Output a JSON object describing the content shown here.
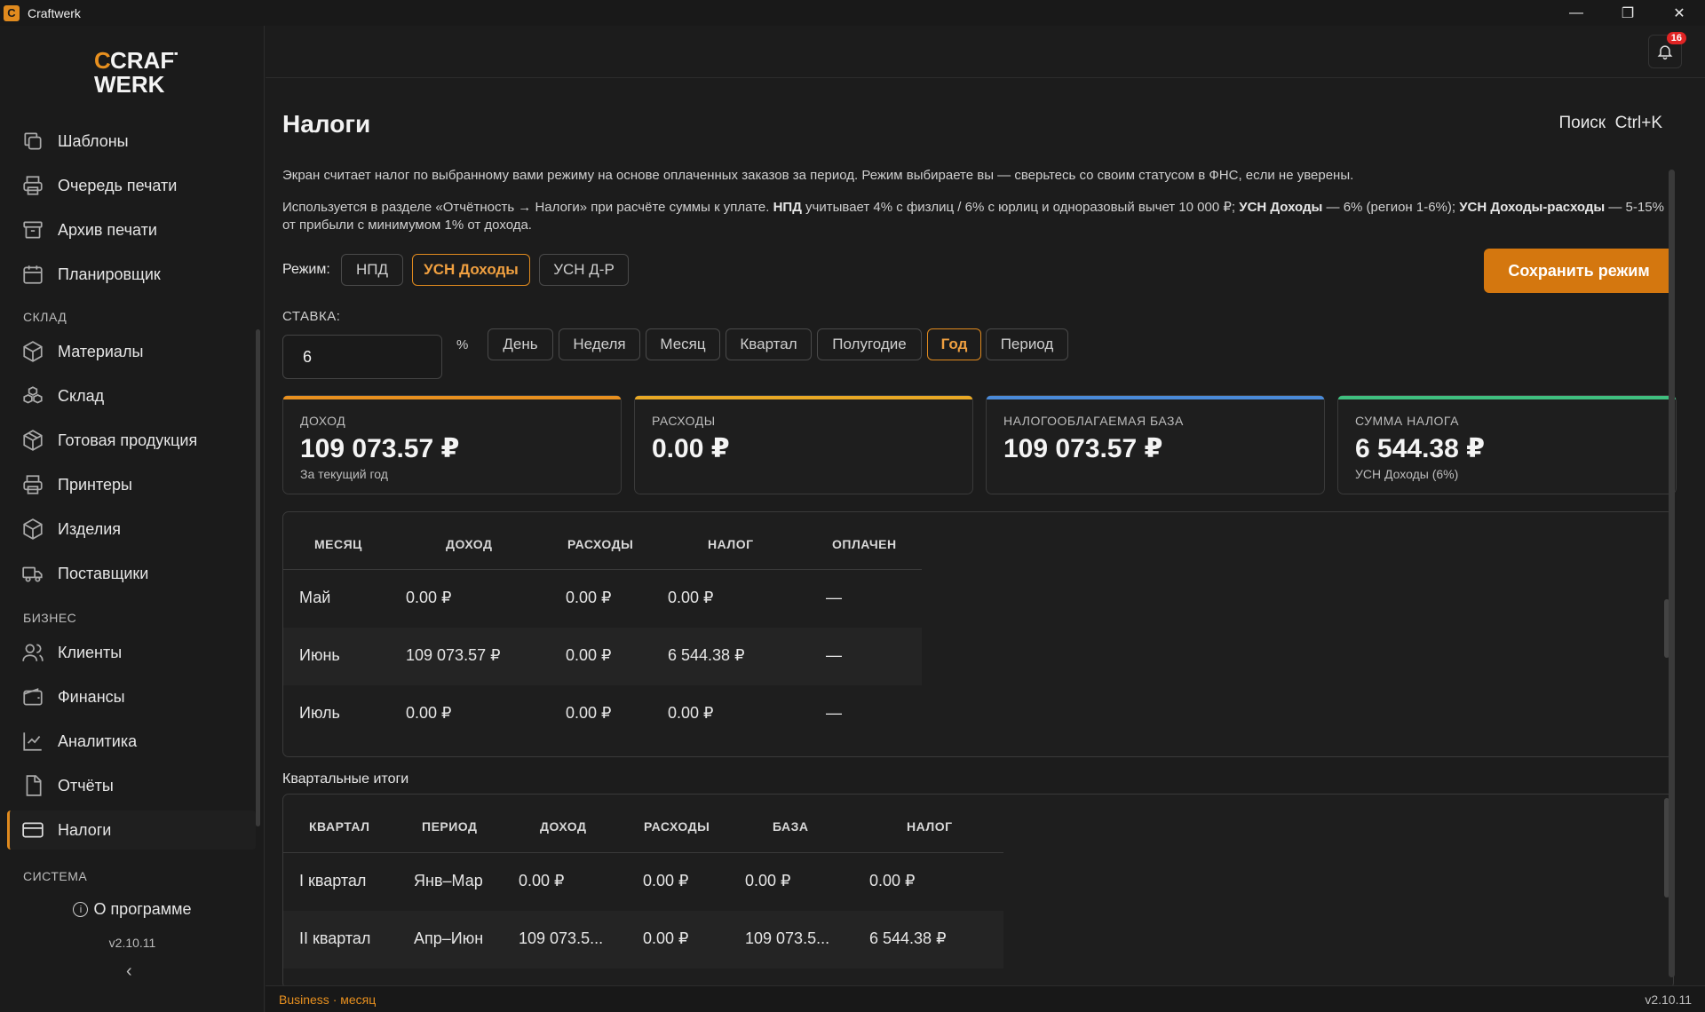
{
  "window": {
    "title": "Craftwerk",
    "minimize": "—",
    "restore": "❐",
    "close": "✕"
  },
  "sidebar": {
    "logo": {
      "line1": "CRAFT",
      "line2": "WERK"
    },
    "items": [
      {
        "label": "Шаблоны",
        "icon": "templates-icon"
      },
      {
        "label": "Очередь печати",
        "icon": "printer-icon"
      },
      {
        "label": "Архив печати",
        "icon": "archive-icon"
      },
      {
        "label": "Планировщик",
        "icon": "calendar-icon"
      },
      {
        "label": "Материалы",
        "icon": "box-icon"
      },
      {
        "label": "Склад",
        "icon": "boxes-icon"
      },
      {
        "label": "Готовая продукция",
        "icon": "package-icon"
      },
      {
        "label": "Принтеры",
        "icon": "printer-icon"
      },
      {
        "label": "Изделия",
        "icon": "cube-icon"
      },
      {
        "label": "Поставщики",
        "icon": "truck-icon"
      },
      {
        "label": "Клиенты",
        "icon": "users-icon"
      },
      {
        "label": "Финансы",
        "icon": "wallet-icon"
      },
      {
        "label": "Аналитика",
        "icon": "chart-icon"
      },
      {
        "label": "Отчёты",
        "icon": "document-icon"
      },
      {
        "label": "Налоги",
        "icon": "card-icon"
      }
    ],
    "sections": {
      "warehouse": "СКЛАД",
      "business": "БИЗНЕС",
      "system": "СИСТЕМА"
    },
    "about": "О программе",
    "version": "v2.10.11",
    "collapse_glyph": "‹"
  },
  "header": {
    "notifications_count": "16"
  },
  "page": {
    "title": "Налоги",
    "search_hint": "Поиск  Ctrl+K",
    "description1": "Экран считает налог по выбранному вами режиму на основе оплаченных заказов за период. Режим выбираете вы — сверьтесь со своим статусом в ФНС, если не уверены.",
    "description2": {
      "p1": "Используется в разделе «Отчётность → Налоги» при расчёте суммы к уплате. ",
      "b1": "НПД",
      "p2": " учитывает 4% с физлиц / 6% с юрлиц и одноразовый вычет 10 000 ₽; ",
      "b2": "УСН Доходы",
      "p3": " — 6% (регион 1-6%); ",
      "b3": "УСН Доходы-расходы",
      "p4": " — 5-15% от прибыли с минимумом 1% от дохода."
    },
    "mode_label": "Режим:",
    "modes": [
      "НПД",
      "УСН Доходы",
      "УСН Д-Р"
    ],
    "active_mode": "УСН Доходы",
    "save_button": "Сохранить режим",
    "rate_label": "СТАВКА:",
    "rate_value": "6",
    "rate_unit": "%",
    "periods": [
      "День",
      "Неделя",
      "Месяц",
      "Квартал",
      "Полугодие",
      "Год",
      "Период"
    ],
    "active_period": "Год"
  },
  "cards": [
    {
      "label": "ДОХОД",
      "value": "109 073.57 ₽",
      "sub": "За текущий год",
      "accent": "#e8901f"
    },
    {
      "label": "РАСХОДЫ",
      "value": "0.00 ₽",
      "sub": "",
      "accent": "#e8a825"
    },
    {
      "label": "НАЛОГООБЛАГАЕМАЯ БАЗА",
      "value": "109 073.57 ₽",
      "sub": "",
      "accent": "#4a8ad8"
    },
    {
      "label": "СУММА НАЛОГА",
      "value": "6 544.38 ₽",
      "sub": "УСН Доходы (6%)",
      "accent": "#3fbf7f"
    }
  ],
  "monthly_table": {
    "headers": [
      "МЕСЯЦ",
      "ДОХОД",
      "РАСХОДЫ",
      "НАЛОГ",
      "ОПЛАЧЕН"
    ],
    "rows": [
      [
        "Май",
        "0.00 ₽",
        "0.00 ₽",
        "0.00 ₽",
        "—"
      ],
      [
        "Июнь",
        "109 073.57 ₽",
        "0.00 ₽",
        "6 544.38 ₽",
        "—"
      ],
      [
        "Июль",
        "0.00 ₽",
        "0.00 ₽",
        "0.00 ₽",
        "—"
      ]
    ]
  },
  "quarterly": {
    "title": "Квартальные итоги",
    "headers": [
      "КВАРТАЛ",
      "ПЕРИОД",
      "ДОХОД",
      "РАСХОДЫ",
      "БАЗА",
      "НАЛОГ"
    ],
    "rows": [
      [
        "I квартал",
        "Янв–Мар",
        "0.00 ₽",
        "0.00 ₽",
        "0.00 ₽",
        "0.00 ₽"
      ],
      [
        "II квартал",
        "Апр–Июн",
        "109 073.5...",
        "0.00 ₽",
        "109 073.5...",
        "6 544.38 ₽"
      ]
    ]
  },
  "statusbar": {
    "left": "Business · месяц",
    "right": "v2.10.11"
  },
  "colors": {
    "accent": "#e08a1e",
    "save_button": "#d4770f",
    "badge": "#e02424"
  }
}
